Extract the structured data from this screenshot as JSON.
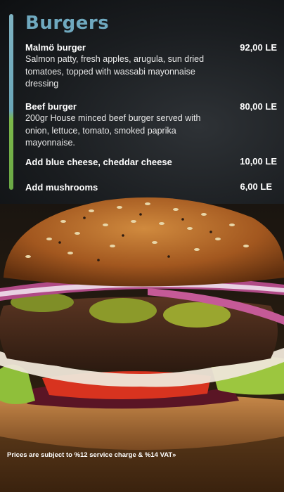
{
  "menu": {
    "title": "Burgers",
    "items": [
      {
        "name": "Malmö burger",
        "price": "92,00 LE",
        "description": "Salmon patty, fresh apples, arugula, sun dried tomatoes, topped with wassabi mayonnaise dressing"
      },
      {
        "name": "Beef burger",
        "price": "80,00 LE",
        "description": "200gr House minced beef burger served with onion, lettuce, tomato, smoked paprika mayonnaise."
      }
    ],
    "addons": [
      {
        "name": "Add blue cheese, cheddar cheese",
        "price": "10,00 LE"
      },
      {
        "name": "Add mushrooms",
        "price": "6,00 LE"
      }
    ],
    "footnote": "Prices are subject to %12 service charge & %14 VAT»"
  },
  "colors": {
    "title": "#6fa9bf",
    "accent_top": "#7fb3c2",
    "accent_bottom": "#6aa845"
  }
}
